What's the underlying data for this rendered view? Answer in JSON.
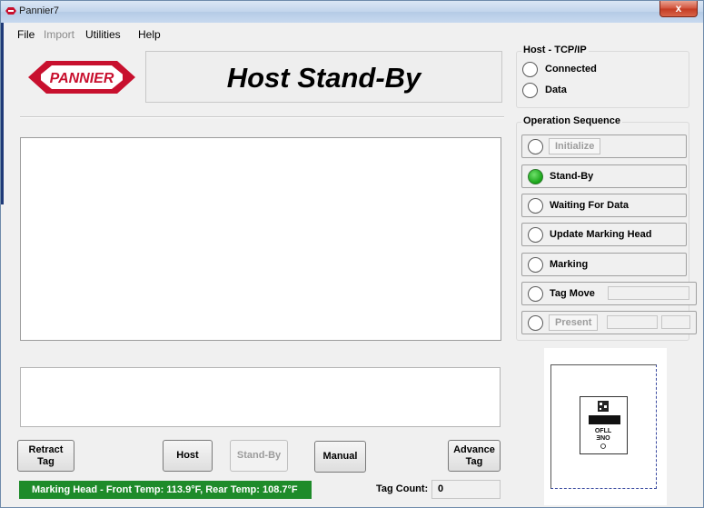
{
  "window": {
    "title": "Pannier7",
    "close_label": "x"
  },
  "menu": [
    {
      "label": "File",
      "enabled": true
    },
    {
      "label": "Import",
      "enabled": false
    },
    {
      "label": "Utilities",
      "enabled": true
    },
    {
      "label": "Help",
      "enabled": true
    }
  ],
  "logo": {
    "text": "PANNIER",
    "colors": {
      "red": "#c8102e",
      "white": "#ffffff"
    }
  },
  "status": {
    "text": "Host Stand-By"
  },
  "host_tcp": {
    "title": "Host - TCP/IP",
    "items": [
      {
        "label": "Connected",
        "on": false
      },
      {
        "label": "Data",
        "on": false
      }
    ]
  },
  "operation": {
    "title": "Operation Sequence",
    "steps": [
      {
        "label": "Initialize",
        "active": false,
        "enabled": false
      },
      {
        "label": "Stand-By",
        "active": true,
        "enabled": true
      },
      {
        "label": "Waiting For Data",
        "active": false,
        "enabled": true
      },
      {
        "label": "Update Marking Head",
        "active": false,
        "enabled": true
      },
      {
        "label": "Marking",
        "active": false,
        "enabled": true
      },
      {
        "label": "Tag Move",
        "active": false,
        "enabled": true,
        "field": ""
      },
      {
        "label": "Present",
        "active": false,
        "enabled": false,
        "field": "",
        "field2": ""
      }
    ],
    "active_color": "#1ea31e"
  },
  "buttons": {
    "retract": "Retract Tag",
    "host": "Host",
    "standby": "Stand-By",
    "manual": "Manual",
    "advance": "Advance Tag"
  },
  "temps": {
    "text": "Marking Head - Front Temp: 113.9°F, Rear Temp: 108.7°F",
    "color": "#1e8b2a"
  },
  "tag_count": {
    "label": "Tag Count:",
    "value": "0"
  },
  "preview": {
    "tag_text_1": "OFLL",
    "tag_text_2": "ƎNO"
  }
}
